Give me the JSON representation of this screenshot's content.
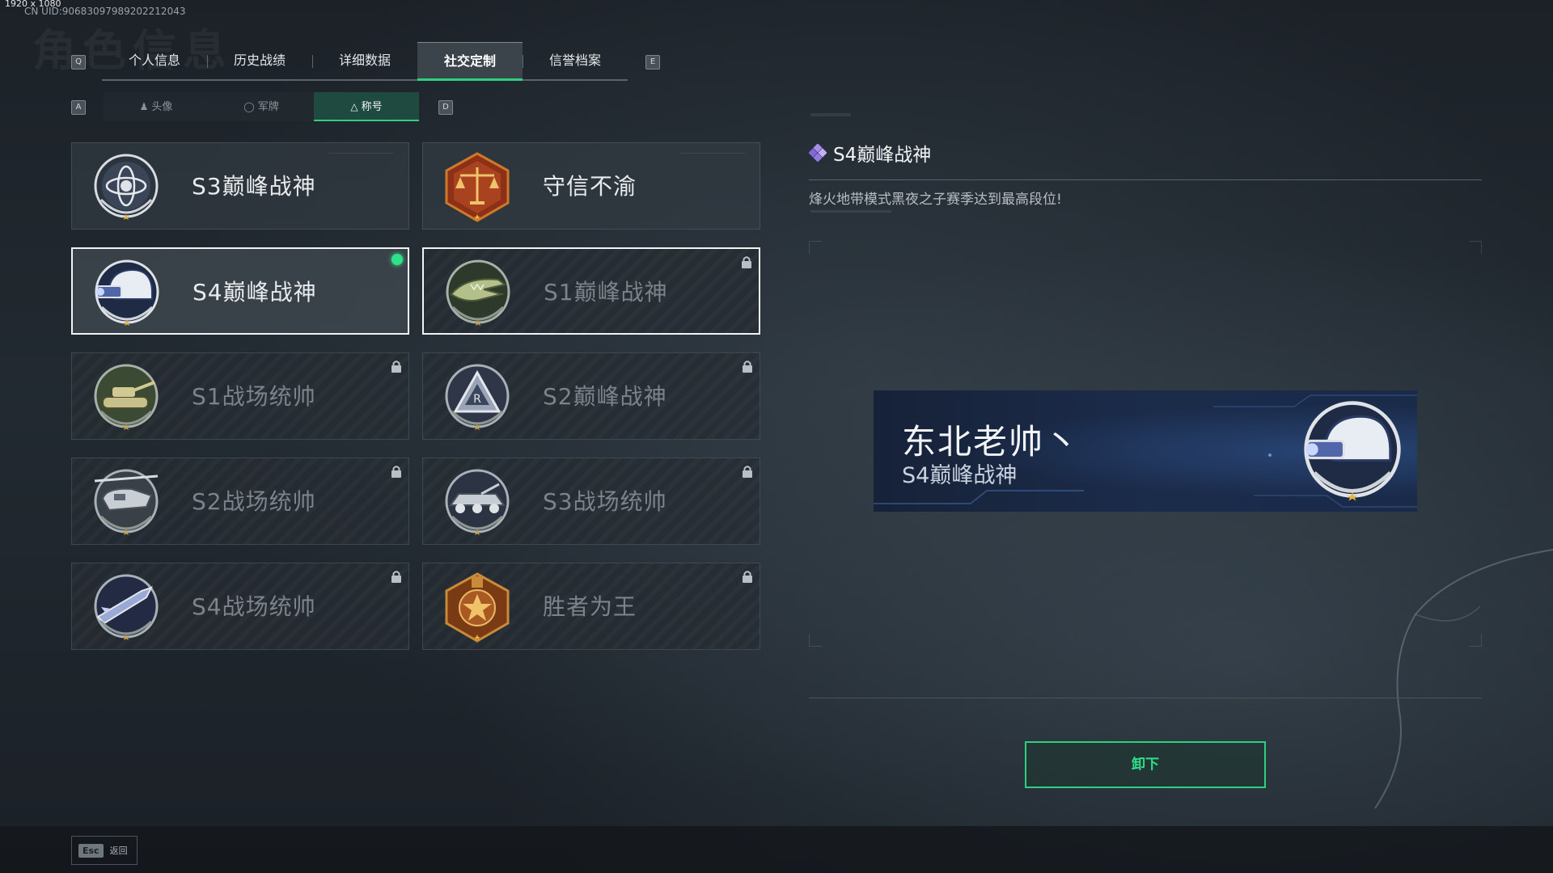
{
  "overlay": {
    "dimensions": "1920 x 1080",
    "uid": "CN UID:9068309798920221204​3"
  },
  "header": {
    "ghost_title": "角色信息"
  },
  "main_tabs": {
    "left_key": "Q",
    "right_key": "E",
    "items": [
      {
        "label": "个人信息"
      },
      {
        "label": "历史战绩"
      },
      {
        "label": "详细数据"
      },
      {
        "label": "社交定制",
        "active": true
      },
      {
        "label": "信誉档案"
      }
    ]
  },
  "sub_tabs": {
    "left_key": "A",
    "right_key": "D",
    "items": [
      {
        "label": "头像",
        "icon": "person-icon"
      },
      {
        "label": "军牌",
        "icon": "dogtag-icon"
      },
      {
        "label": "称号",
        "icon": "title-icon",
        "active": true
      }
    ]
  },
  "titles": [
    {
      "name": "S3巅峰战神",
      "badge": "armillary-badge",
      "locked": false,
      "equipped": false
    },
    {
      "name": "守信不渝",
      "badge": "scales-badge",
      "locked": false,
      "equipped": false
    },
    {
      "name": "S4巅峰战神",
      "badge": "nightvision-helmet-badge",
      "locked": false,
      "equipped": true
    },
    {
      "name": "S1巅峰战神",
      "badge": "crocodile-badge",
      "locked": true,
      "equipped": false
    },
    {
      "name": "S1战场统帅",
      "badge": "tank-badge",
      "locked": true,
      "equipped": false
    },
    {
      "name": "S2巅峰战神",
      "badge": "pyramid-badge",
      "locked": true,
      "equipped": false
    },
    {
      "name": "S2战场统帅",
      "badge": "helicopter-badge",
      "locked": true,
      "equipped": false
    },
    {
      "name": "S3战场统帅",
      "badge": "armored-vehicle-badge",
      "locked": true,
      "equipped": false
    },
    {
      "name": "S4战场统帅",
      "badge": "missile-badge",
      "locked": true,
      "equipped": false
    },
    {
      "name": "胜者为王",
      "badge": "medal-badge",
      "locked": true,
      "equipped": false
    }
  ],
  "detail": {
    "title": "S4巅峰战神",
    "description": "烽火地带模式黑夜之子赛季达到最高段位!",
    "preview": {
      "player_name": "东北老帅丶",
      "title": "S4巅峰战神"
    },
    "action_label": "卸下"
  },
  "footer": {
    "key": "Esc",
    "label": "返回"
  },
  "colors": {
    "accent": "#2fcf80",
    "equipped_dot": "#2fe08a"
  }
}
